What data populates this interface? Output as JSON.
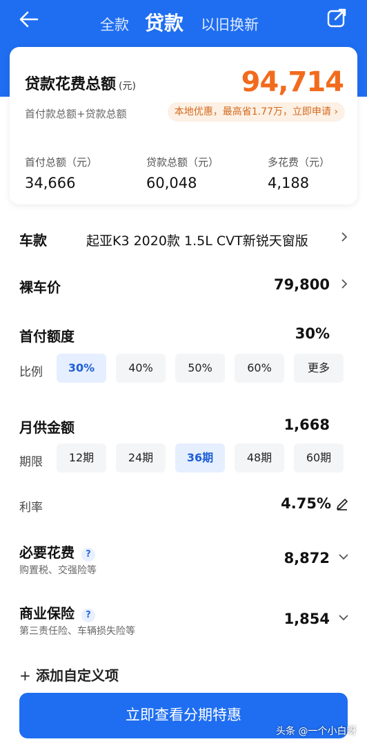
{
  "header": {
    "tabs": [
      {
        "label": "全款"
      },
      {
        "label": "贷款"
      },
      {
        "label": "以旧换新"
      }
    ],
    "back_icon": "arrow-left-icon",
    "share_icon": "share-icon"
  },
  "summary": {
    "title": "贷款花费总额",
    "unit": "(元)",
    "total": "94,714",
    "subtitle": "首付款总额+贷款总额",
    "promo": "本地优惠，最高省1.77万，立即申请 ›",
    "stats": [
      {
        "label": "首付总额（元）",
        "value": "34,666"
      },
      {
        "label": "贷款总额（元）",
        "value": "60,048"
      },
      {
        "label": "多花费（元）",
        "value": "4,188"
      }
    ]
  },
  "model": {
    "label": "车款",
    "value": "起亚K3 2020款 1.5L CVT新锐天窗版"
  },
  "price": {
    "label": "裸车价",
    "value": "79,800"
  },
  "down_payment": {
    "label": "首付额度",
    "value": "30%",
    "ratio_label": "比例",
    "options": [
      "30%",
      "40%",
      "50%",
      "60%",
      "更多"
    ],
    "selected": "30%"
  },
  "monthly": {
    "label": "月供金额",
    "value": "1,668",
    "term_label": "期限",
    "options": [
      "12期",
      "24期",
      "36期",
      "48期",
      "60期"
    ],
    "selected": "36期"
  },
  "rate": {
    "label": "利率",
    "value": "4.75%"
  },
  "required_fees": {
    "label": "必要花费",
    "help": "?",
    "sub": "购置税、交强险等",
    "value": "8,872"
  },
  "insurance": {
    "label": "商业保险",
    "help": "?",
    "sub": "第三责任险、车辆损失险等",
    "value": "1,854"
  },
  "add_custom": {
    "plus": "+",
    "label": "添加自定义项"
  },
  "cta": {
    "label": "立即查看分期特惠"
  },
  "watermark": "头条 @一个小白呀",
  "colors": {
    "brand_blue": "#1f6ef1",
    "total_orange": "#f26b1d",
    "promo_bg": "#fdf0e4"
  }
}
